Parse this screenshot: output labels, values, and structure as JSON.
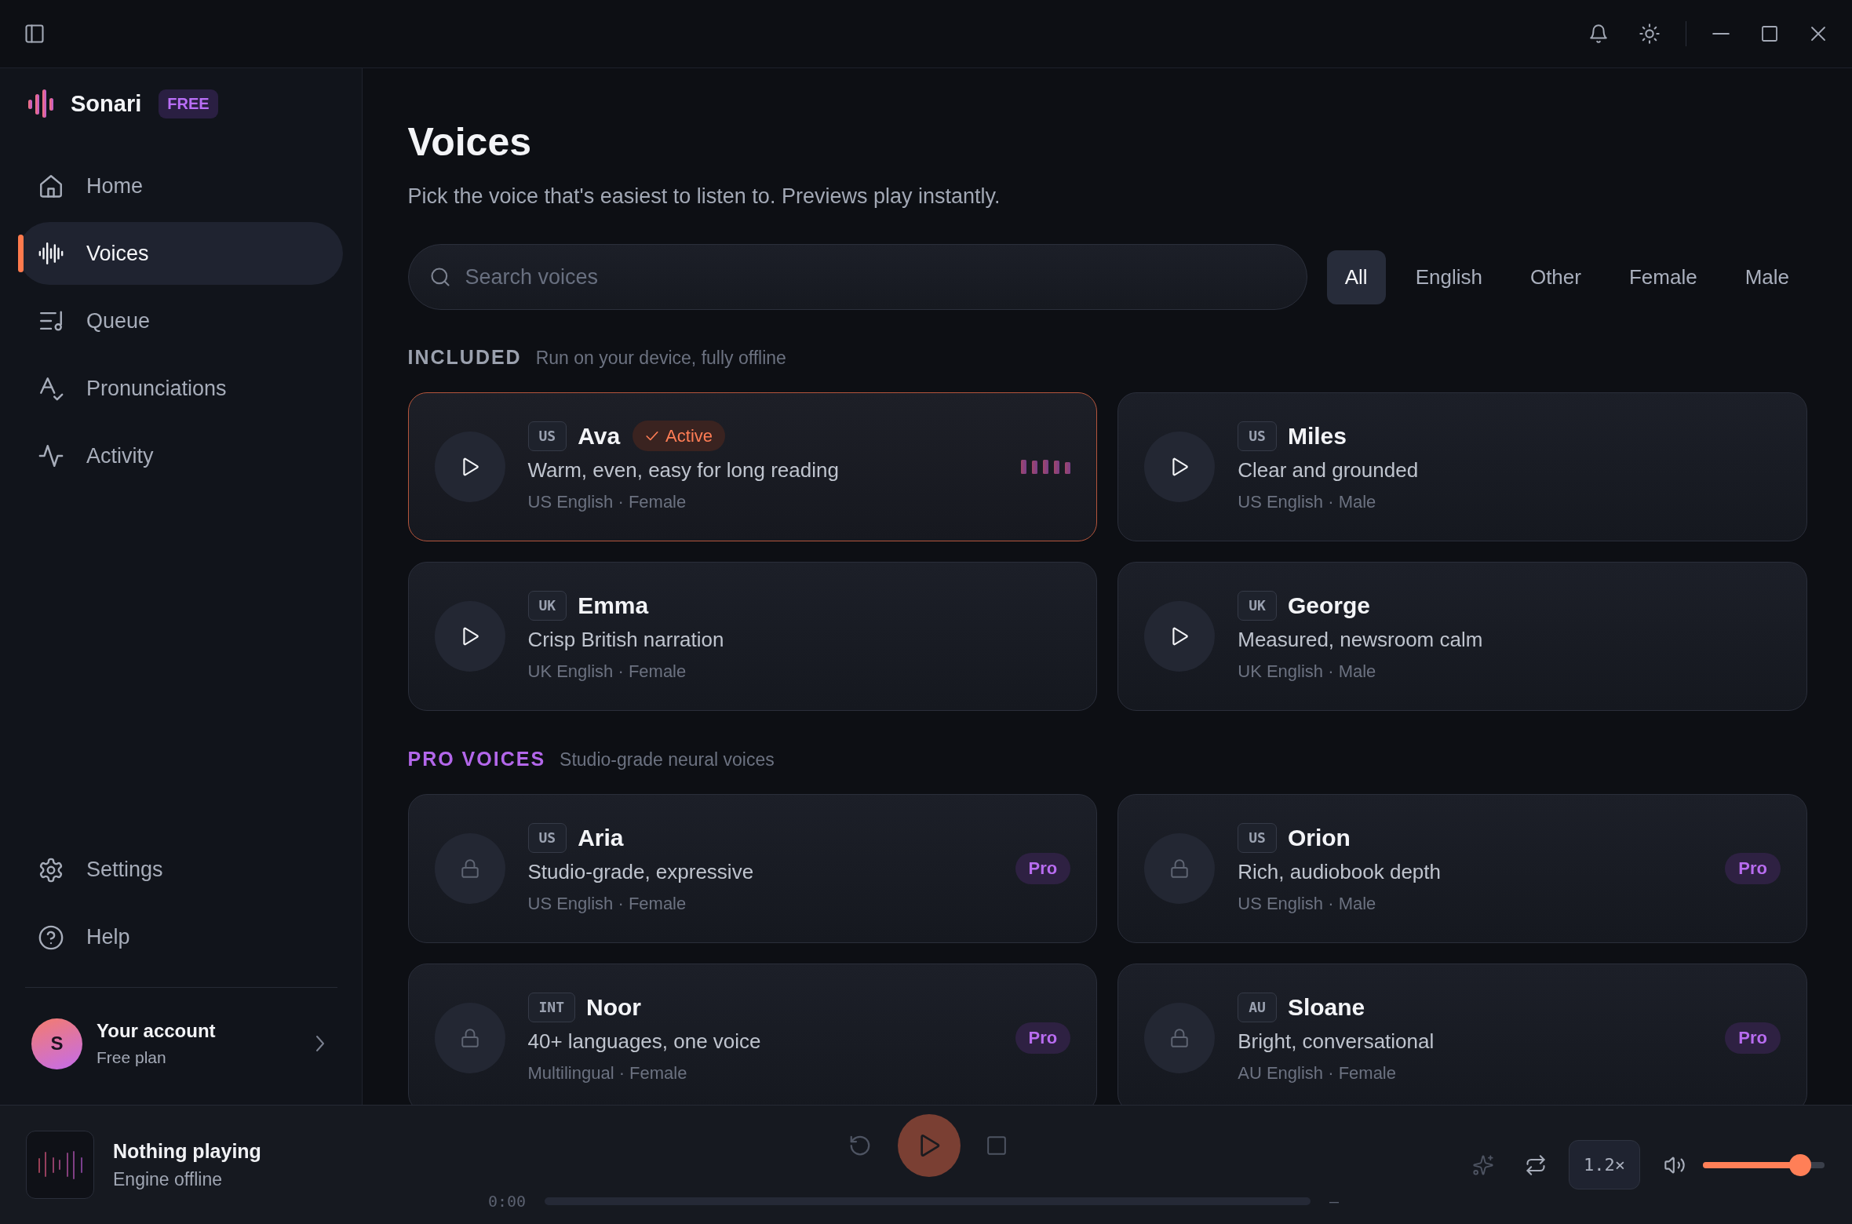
{
  "sidebar": {
    "brand": {
      "name": "Sonari",
      "badge": "FREE"
    },
    "nav": [
      {
        "label": "Home",
        "selected": false
      },
      {
        "label": "Voices",
        "selected": true
      },
      {
        "label": "Queue",
        "selected": false
      },
      {
        "label": "Pronunciations",
        "selected": false
      },
      {
        "label": "Activity",
        "selected": false
      }
    ],
    "footer_nav": [
      {
        "label": "Settings"
      },
      {
        "label": "Help"
      }
    ],
    "account": {
      "initial": "S",
      "name": "Your account",
      "plan": "Free plan"
    }
  },
  "page": {
    "title": "Voices",
    "subtitle": "Pick the voice that's easiest to listen to. Previews play instantly.",
    "search": {
      "placeholder": "Search voices"
    },
    "filters": [
      {
        "label": "All",
        "selected": true
      },
      {
        "label": "English",
        "selected": false
      },
      {
        "label": "Other",
        "selected": false
      },
      {
        "label": "Female",
        "selected": false
      },
      {
        "label": "Male",
        "selected": false
      }
    ],
    "sections": [
      {
        "kind": "included",
        "title": "INCLUDED",
        "note": "Run on your device, fully offline",
        "voices": [
          {
            "region": "US",
            "name": "Ava",
            "status": "Active",
            "active": true,
            "locked": false,
            "description": "Warm, even, easy for long reading",
            "meta": "US English · Female"
          },
          {
            "region": "US",
            "name": "Miles",
            "active": false,
            "locked": false,
            "description": "Clear and grounded",
            "meta": "US English · Male"
          },
          {
            "region": "UK",
            "name": "Emma",
            "active": false,
            "locked": false,
            "description": "Crisp British narration",
            "meta": "UK English · Female"
          },
          {
            "region": "UK",
            "name": "George",
            "active": false,
            "locked": false,
            "description": "Measured, newsroom calm",
            "meta": "UK English · Male"
          }
        ]
      },
      {
        "kind": "pro",
        "title": "PRO VOICES",
        "note": "Studio-grade neural voices",
        "voices": [
          {
            "region": "US",
            "name": "Aria",
            "active": false,
            "locked": true,
            "badge": "Pro",
            "description": "Studio-grade, expressive",
            "meta": "US English · Female"
          },
          {
            "region": "US",
            "name": "Orion",
            "active": false,
            "locked": true,
            "badge": "Pro",
            "description": "Rich, audiobook depth",
            "meta": "US English · Male"
          },
          {
            "region": "INT",
            "name": "Noor",
            "active": false,
            "locked": true,
            "badge": "Pro",
            "description": "40+ languages, one voice",
            "meta": "Multilingual · Female"
          },
          {
            "region": "AU",
            "name": "Sloane",
            "active": false,
            "locked": true,
            "badge": "Pro",
            "description": "Bright, conversational",
            "meta": "AU English · Female"
          }
        ]
      }
    ]
  },
  "player": {
    "title": "Nothing playing",
    "status": "Engine offline",
    "disabled": true,
    "elapsed": "0:00",
    "duration": "–",
    "speed": "1.2×",
    "volume": {
      "level": 0.8
    }
  }
}
